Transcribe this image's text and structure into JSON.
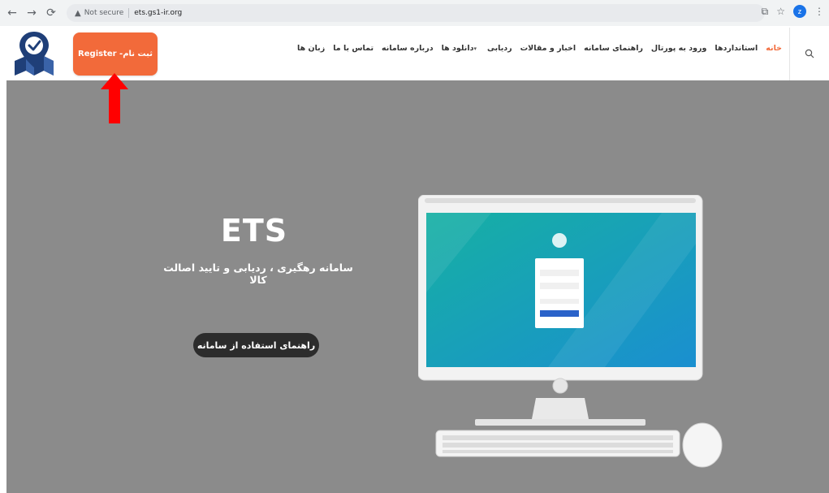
{
  "browser": {
    "back_icon": "arrow-left-icon",
    "forward_icon": "arrow-right-icon",
    "reload_icon": "reload-icon",
    "security_text": "Not secure",
    "url": "ets.gs1-ir.org",
    "profile_initial": "z"
  },
  "header": {
    "register_label": "Register -ثبت نام",
    "menu": [
      {
        "label": "خانه",
        "active": true
      },
      {
        "label": "استانداردها"
      },
      {
        "label": "ورود به پورتال"
      },
      {
        "label": "راهنمای سامانه"
      },
      {
        "label": "اخبار و مقالات"
      },
      {
        "label": "ردیابی"
      },
      {
        "label": "دانلود ها"
      },
      {
        "label": "درباره سامانه"
      },
      {
        "label": "تماس با ما"
      },
      {
        "label": "زبان ها"
      }
    ],
    "accent_color": "#f26a3a"
  },
  "hero": {
    "title": "ETS",
    "subtitle": "سامانه رهگیری ، ردیابی و تایید اصالت کالا",
    "guide_button": "راهنمای استفاده از سامانه",
    "background_color": "#8b8b8b"
  }
}
